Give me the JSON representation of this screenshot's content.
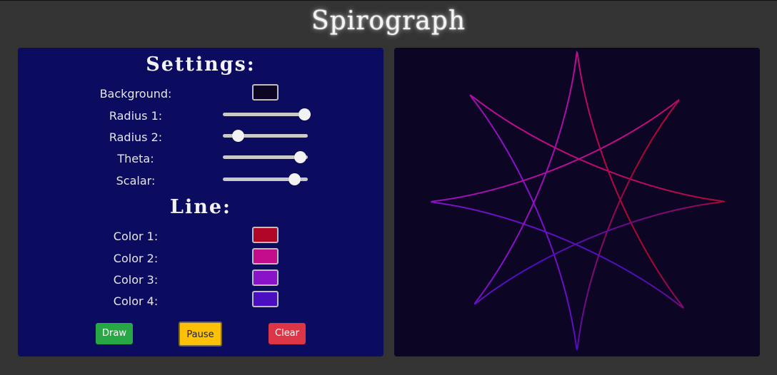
{
  "app": {
    "title": "Spirograph"
  },
  "settings": {
    "heading": "Settings:",
    "background": {
      "label": "Background:",
      "color": "#0c0524"
    },
    "sliders": [
      {
        "label": "Radius 1:",
        "value": 0.96
      },
      {
        "label": "Radius 2:",
        "value": 0.18
      },
      {
        "label": "Theta:",
        "value": 0.91
      },
      {
        "label": "Scalar:",
        "value": 0.84
      }
    ]
  },
  "line": {
    "heading": "Line:",
    "colors": [
      {
        "label": "Color 1:",
        "color": "#b00628"
      },
      {
        "label": "Color 2:",
        "color": "#c40d8c"
      },
      {
        "label": "Color 3:",
        "color": "#8a12c8"
      },
      {
        "label": "Color 4:",
        "color": "#4a0fc0"
      }
    ]
  },
  "buttons": {
    "draw": "Draw",
    "pause": "Pause",
    "clear": "Clear"
  },
  "canvas": {
    "background": "#0c0524"
  }
}
